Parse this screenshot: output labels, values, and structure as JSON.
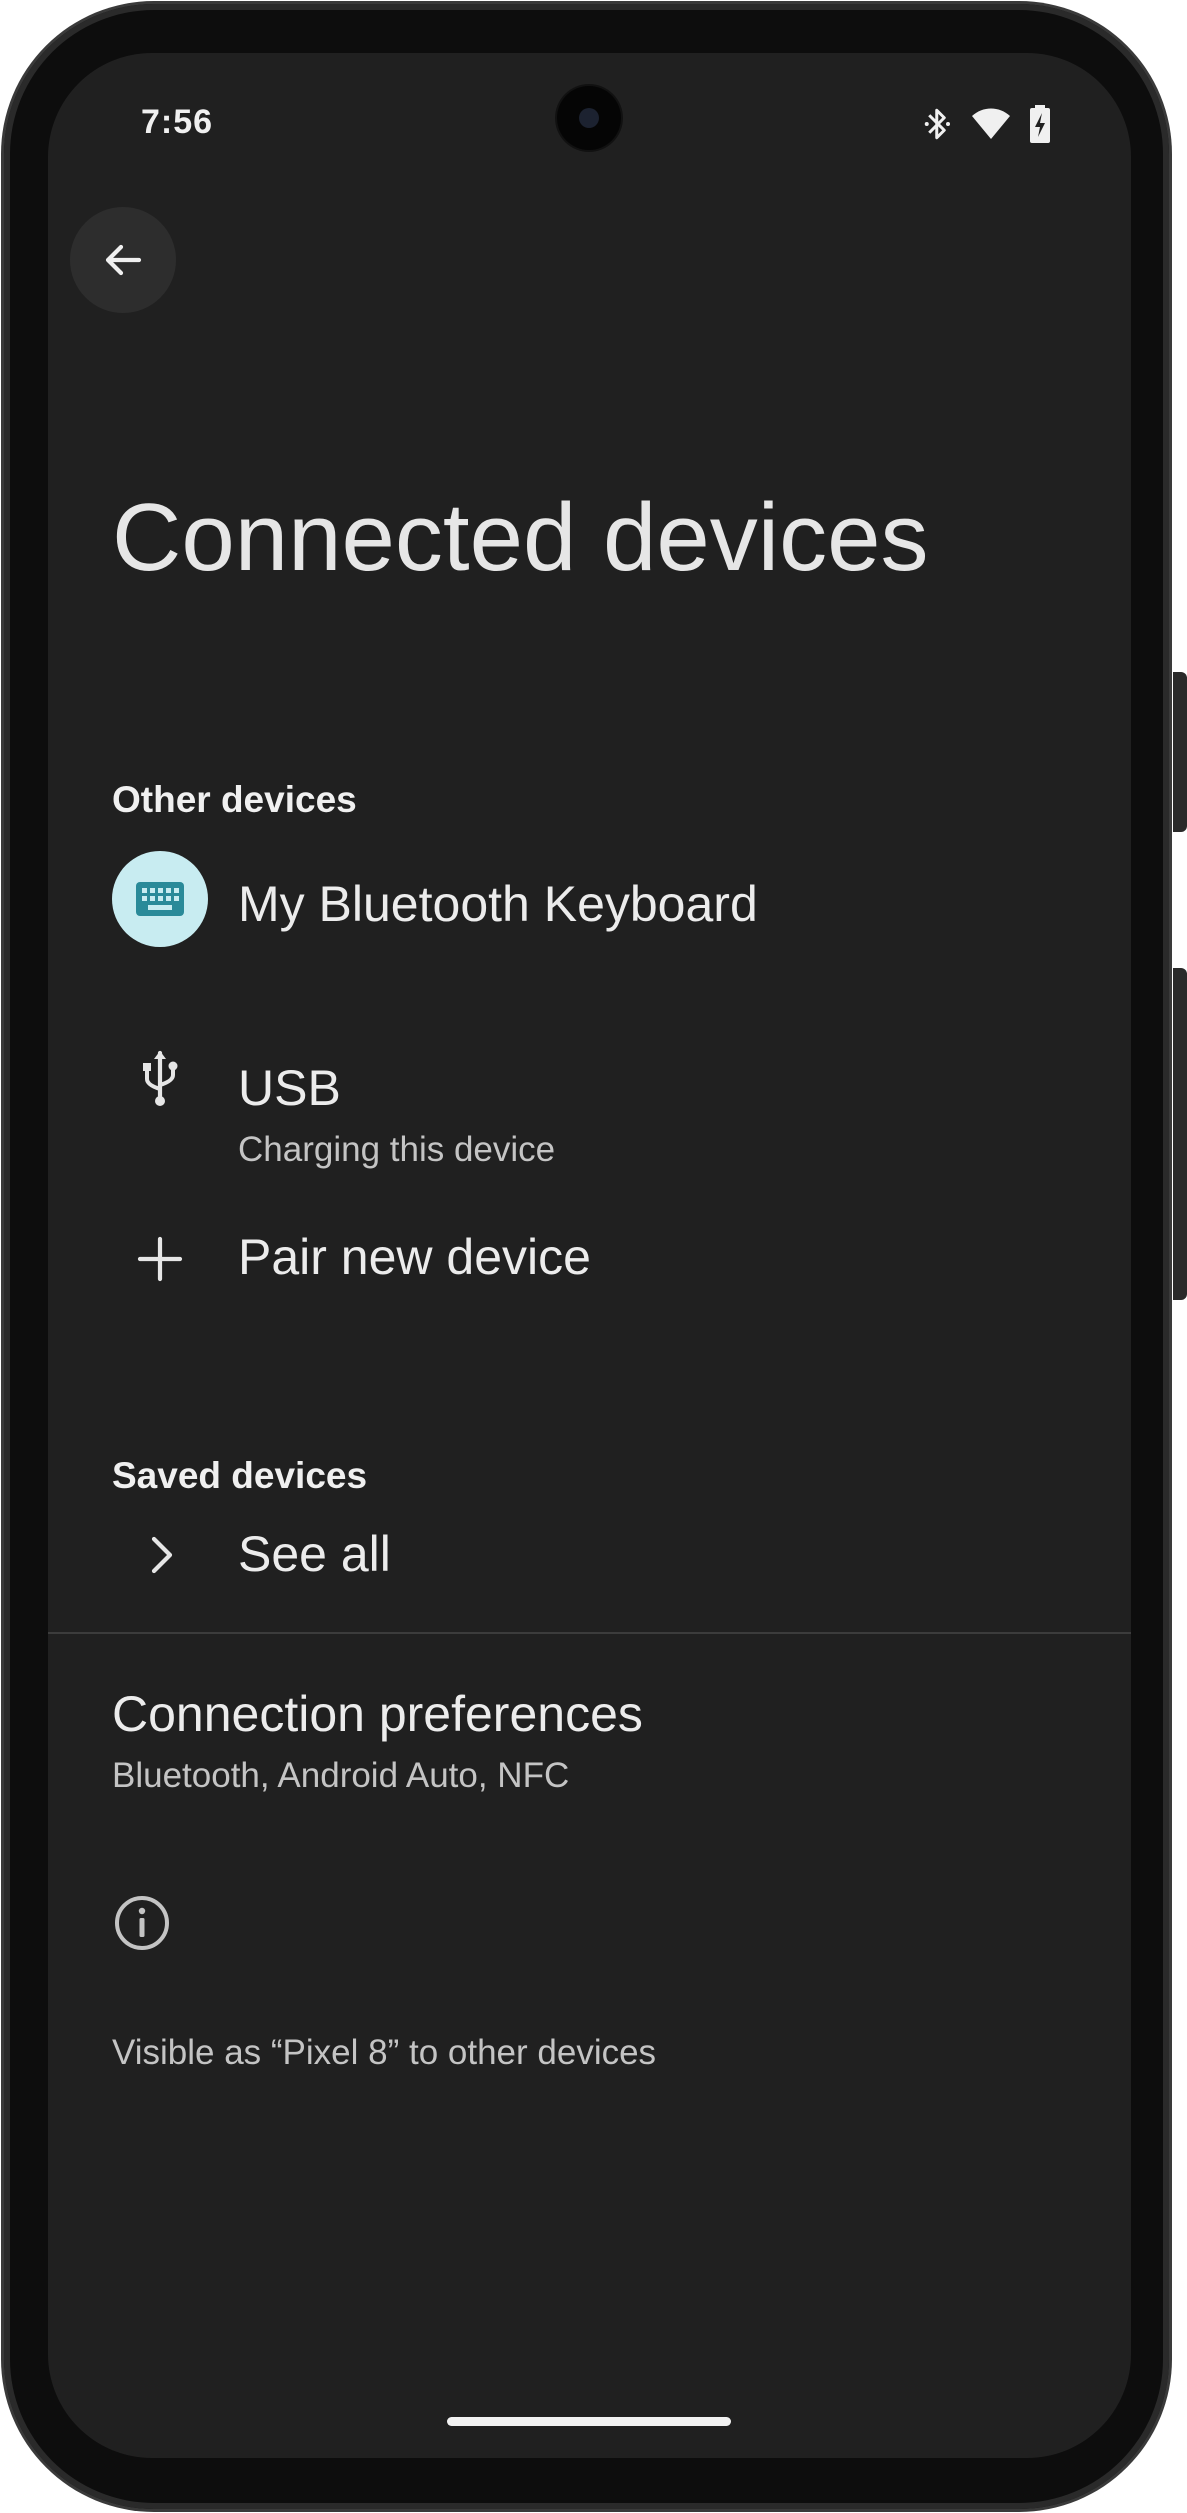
{
  "status_bar": {
    "time": "7:56",
    "icons": [
      "bluetooth-icon",
      "wifi-icon",
      "battery-charging-icon"
    ]
  },
  "header": {
    "back_icon": "arrow-back-icon",
    "title": "Connected devices"
  },
  "other_devices": {
    "header": "Other devices",
    "items": [
      {
        "icon": "keyboard-icon",
        "title": "My Bluetooth Keyboard"
      },
      {
        "icon": "usb-icon",
        "title": "USB",
        "subtitle": "Charging this device"
      },
      {
        "icon": "plus-icon",
        "title": "Pair new device"
      }
    ]
  },
  "saved_devices": {
    "header": "Saved devices",
    "see_all": {
      "icon": "chevron-right-icon",
      "title": "See all"
    }
  },
  "connection_preferences": {
    "title": "Connection preferences",
    "subtitle": "Bluetooth, Android Auto, NFC"
  },
  "footer": {
    "icon": "info-icon",
    "visible_as": "Visible as “Pixel 8” to other devices"
  },
  "colors": {
    "screen_bg": "#202020",
    "keyboard_circle": "#c8ecf1",
    "keyboard_icon": "#2a8a99"
  }
}
